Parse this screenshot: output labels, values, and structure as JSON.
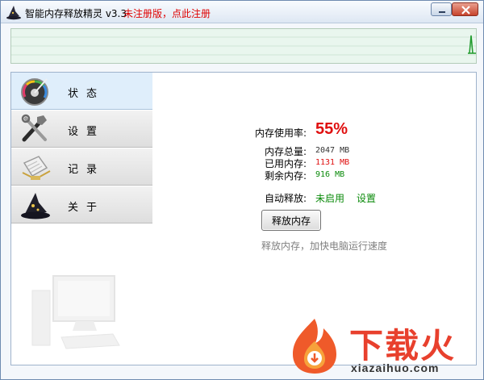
{
  "titlebar": {
    "title": "智能内存释放精灵 v3.3",
    "register_link": "未注册版，点此注册"
  },
  "nav": {
    "items": [
      {
        "label": "状态",
        "icon": "speedometer-icon"
      },
      {
        "label": "设置",
        "icon": "tools-icon"
      },
      {
        "label": "记录",
        "icon": "log-icon"
      },
      {
        "label": "关于",
        "icon": "wizard-hat-icon"
      }
    ],
    "active": 0
  },
  "status": {
    "usage_label": "内存使用率:",
    "usage_value": "55%",
    "total_label": "内存总量:",
    "total_value": "2047 MB",
    "used_label": "已用内存:",
    "used_value": "1131 MB",
    "free_label": "剩余内存:",
    "free_value": "916 MB",
    "auto_label": "自动释放:",
    "auto_status": "未启用",
    "settings_link": "设置",
    "release_button": "释放内存",
    "hint": "释放内存，加快电脑运行速度"
  },
  "brand": {
    "name": "下载火",
    "domain": "xiazaihuo.com"
  },
  "colors": {
    "accent_red": "#e01010",
    "accent_green": "#0a8a0a",
    "brand_red": "#e8402d"
  }
}
